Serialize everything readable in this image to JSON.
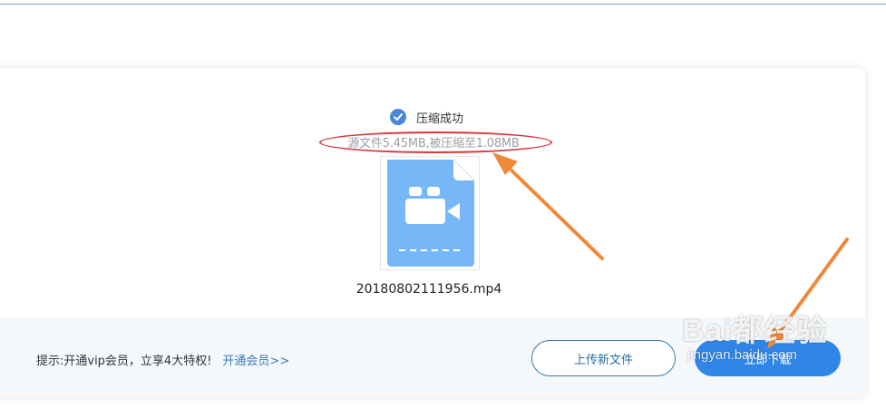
{
  "result": {
    "status_label": "压缩成功",
    "detail_text": "源文件5.45MB,被压缩至1.08MB",
    "file_name": "20180802111956.mp4"
  },
  "footer": {
    "tip_text": "提示:开通vip会员，立享4大特权!",
    "vip_link": "开通会员>>",
    "upload_button": "上传新文件",
    "download_button": "立即下载"
  },
  "watermark": {
    "brand": "Bai都经验",
    "url": "jingyan.baidu.com"
  },
  "colors": {
    "accent": "#2f86e8",
    "check": "#4c86d8",
    "file_icon": "#78b7f7",
    "annotation_oval": "#d9363e",
    "annotation_arrow": "#f0883a"
  },
  "icons": {
    "status": "check-circle-icon",
    "file": "video-file-icon"
  }
}
